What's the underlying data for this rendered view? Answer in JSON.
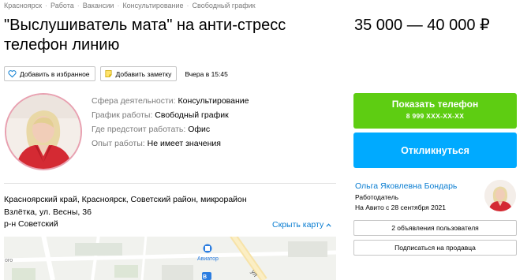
{
  "breadcrumbs": [
    "Красноярск",
    "Работа",
    "Вакансии",
    "Консультирование",
    "Свободный график"
  ],
  "breadcrumb_separator": "·",
  "title": "\"Выслушиватель мата\" на анти-стресс телефон линию",
  "price": "35 000 — 40 000 ₽",
  "actions": {
    "favorite_label": "Добавить в избранное",
    "note_label": "Добавить заметку",
    "posted": "Вчера в 15:45"
  },
  "params": [
    {
      "key": "Сфера деятельности:",
      "value": "Консультирование"
    },
    {
      "key": "График работы:",
      "value": "Свободный график"
    },
    {
      "key": "Где предстоит работать:",
      "value": "Офис"
    },
    {
      "key": "Опыт работы:",
      "value": "Не имеет значения"
    }
  ],
  "address": {
    "line1": "Красноярский край, Красноярск, Советский район, микрорайон",
    "line2": "Взлётка, ул. Весны, 36",
    "district": "р-н Советский",
    "map_link": "Скрыть карту"
  },
  "map": {
    "poi_label": "Авиатор",
    "edge_label": "ого",
    "street_fragment": "ул"
  },
  "contact": {
    "phone_button": "Показать телефон",
    "phone_masked": "8 999 XXX-XX-XX",
    "reply_button": "Откликнуться"
  },
  "seller": {
    "name": "Ольга Яковлевна Бондарь",
    "role": "Работодатель",
    "since": "На Авито с 28 сентября 2021",
    "ads_button": "2 объявления пользователя",
    "subscribe_button": "Подписаться на продавца"
  },
  "colors": {
    "green": "#5ecd12",
    "blue": "#00aaff",
    "link": "#0a7dd1"
  }
}
